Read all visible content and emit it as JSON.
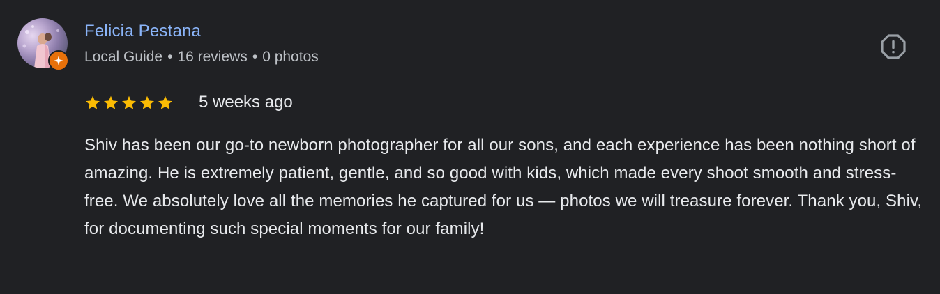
{
  "review": {
    "author_name": "Felicia Pestana",
    "author_meta": {
      "role": "Local Guide",
      "reviews": "16 reviews",
      "photos": "0 photos",
      "separator": "•"
    },
    "rating": 5,
    "rating_max": 5,
    "time_ago": "5 weeks ago",
    "text": "Shiv has been our go-to newborn photographer for all our sons, and each experience has been nothing short of amazing. He is extremely patient, gentle, and so good with kids, which made every shoot smooth and stress-free. We absolutely love all the memories he captured for us — photos we will treasure forever. Thank you, Shiv, for documenting such special moments for our family!",
    "icons": {
      "avatar": "profile-photo",
      "badge": "local-guide-badge-icon",
      "report": "report-icon",
      "star": "star-icon"
    }
  },
  "colors": {
    "background": "#202124",
    "name": "#8ab4f8",
    "meta": "#bdc1c6",
    "text": "#e8eaed",
    "star": "#fbbc04",
    "badge": "#e8710a",
    "report_icon": "#9aa0a6"
  }
}
